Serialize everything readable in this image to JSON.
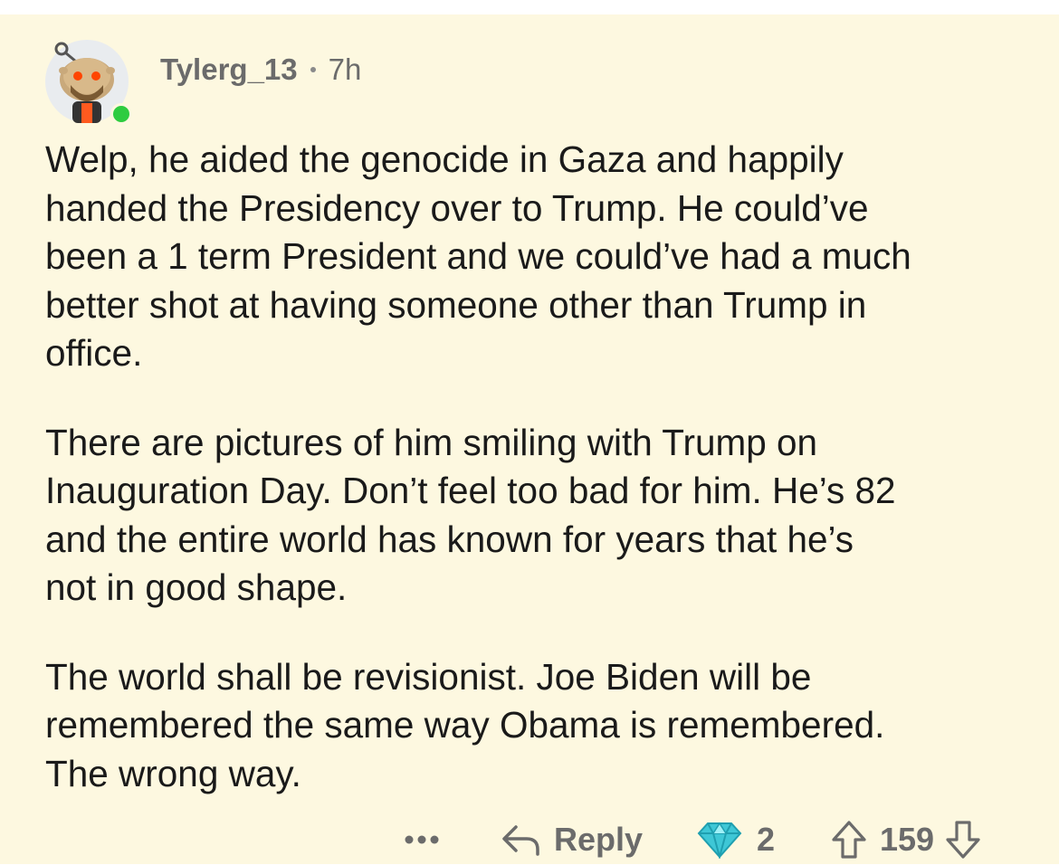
{
  "comment": {
    "username": "Tylerg_13",
    "timestamp": "7h",
    "avatar_icon": "reddit-snoo-avatar-icon",
    "online_status_color": "#2ecc40",
    "paragraphs": [
      "Welp, he aided the genocide in Gaza and happily\nhanded the Presidency over to Trump. He could’ve\nbeen a 1 term President and we could’ve had a much\nbetter shot at having someone other than Trump in\noffice.",
      "There are pictures of him smiling with Trump on\nInauguration Day. Don’t feel too bad for him. He’s 82\nand the entire world has known for years that he’s\nnot in good shape.",
      "The world shall be revisionist. Joe Biden will be\nremembered the same way Obama is remembered.\nThe wrong way."
    ]
  },
  "actions": {
    "more_icon": "ellipsis-icon",
    "reply_icon": "reply-arrow-icon",
    "reply_label": "Reply",
    "award_icon": "diamond-award-icon",
    "award_count": "2",
    "upvote_icon": "upvote-arrow-icon",
    "score": "159",
    "downvote_icon": "downvote-arrow-icon"
  },
  "colors": {
    "background": "#fdf8e0",
    "text": "#1a1a1a",
    "muted": "#6b6b6b",
    "award": "#3ec7d6"
  }
}
